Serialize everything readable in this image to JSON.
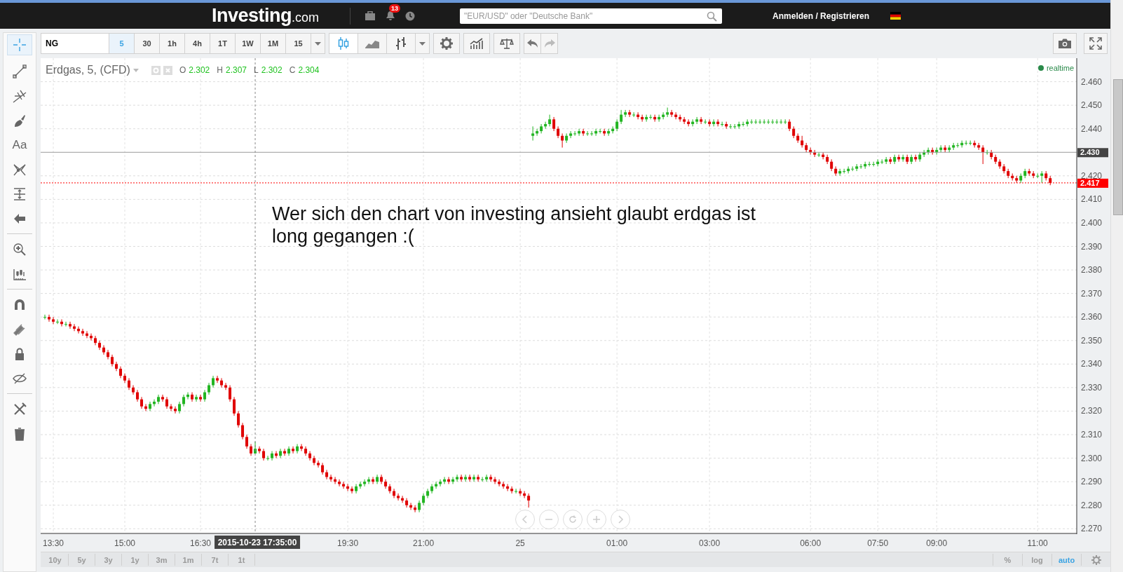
{
  "header": {
    "logo_name": "Investing",
    "logo_suffix": ".com",
    "notification_count": "13",
    "search": {
      "placeholder": "\"EUR/USD\" oder \"Deutsche Bank\""
    },
    "login_link": "Anmelden / Registrieren"
  },
  "toolbar": {
    "symbol": "NG",
    "intervals": [
      {
        "label": "5",
        "selected": true
      },
      {
        "label": "30",
        "selected": false
      },
      {
        "label": "1h",
        "selected": false
      },
      {
        "label": "4h",
        "selected": false
      },
      {
        "label": "1T",
        "selected": false
      },
      {
        "label": "1W",
        "selected": false
      },
      {
        "label": "1M",
        "selected": false
      },
      {
        "label": "15",
        "selected": false
      }
    ],
    "chart_types": [
      {
        "selected": true
      },
      {
        "selected": false
      },
      {
        "selected": false
      }
    ]
  },
  "drawing_tools": [
    {
      "selected": true
    },
    {
      "selected": false
    },
    {
      "selected": false
    },
    {
      "selected": false
    },
    {
      "label": "Aa",
      "selected": false
    },
    {
      "selected": false
    },
    {
      "selected": false
    },
    {
      "selected": false
    },
    {
      "selected": false
    },
    {
      "selected": false
    },
    {
      "selected": false
    },
    {
      "selected": false
    },
    {
      "selected": false
    },
    {
      "selected": false
    },
    {
      "selected": false
    },
    {
      "selected": false
    }
  ],
  "legend": {
    "title": "Erdgas, 5, (CFD)",
    "ohlc": [
      {
        "label": "O",
        "value": "2.302"
      },
      {
        "label": "H",
        "value": "2.307"
      },
      {
        "label": "L",
        "value": "2.302"
      },
      {
        "label": "C",
        "value": "2.304"
      }
    ],
    "status": "realtime"
  },
  "annotation": "Wer sich den chart von investing ansieht glaubt erdgas ist long gegangen :(",
  "chart_data": {
    "type": "candlestick",
    "grid": true,
    "ylim": [
      2.268,
      2.47
    ],
    "categories": [
      null,
      null,
      "13:30",
      null,
      null,
      null,
      null,
      null,
      null,
      null,
      null,
      null,
      null,
      null,
      null,
      null,
      null,
      null,
      null,
      "15:00",
      null,
      null,
      null,
      null,
      null,
      null,
      null,
      null,
      null,
      null,
      null,
      null,
      null,
      null,
      null,
      null,
      null,
      "16:30",
      null,
      null,
      null,
      null,
      null,
      null,
      null,
      null,
      null,
      null,
      null,
      null,
      "2015-10-23 17:35:00",
      null,
      null,
      null,
      null,
      null,
      null,
      null,
      null,
      null,
      null,
      null,
      null,
      null,
      null,
      null,
      null,
      null,
      null,
      null,
      null,
      null,
      "19:30",
      null,
      null,
      null,
      null,
      null,
      null,
      null,
      null,
      null,
      null,
      null,
      null,
      null,
      null,
      null,
      null,
      null,
      "21:00",
      null,
      null,
      null,
      null,
      null,
      null,
      null,
      null,
      null,
      null,
      null,
      null,
      null,
      null,
      null,
      null,
      null,
      null,
      null,
      null,
      null,
      null,
      "25",
      null,
      null,
      null,
      null,
      null,
      null,
      null,
      null,
      null,
      null,
      null,
      null,
      null,
      null,
      null,
      null,
      null,
      null,
      null,
      null,
      null,
      null,
      "01:00",
      null,
      null,
      null,
      null,
      null,
      null,
      null,
      null,
      null,
      null,
      null,
      null,
      null,
      null,
      null,
      null,
      null,
      null,
      null,
      null,
      null,
      "03:00",
      null,
      null,
      null,
      null,
      null,
      null,
      null,
      null,
      null,
      null,
      null,
      null,
      null,
      null,
      null,
      null,
      null,
      null,
      null,
      null,
      null,
      null,
      null,
      "06:00",
      null,
      null,
      null,
      null,
      null,
      null,
      null,
      null,
      null,
      null,
      null,
      null,
      null,
      null,
      null,
      "07:50",
      null,
      null,
      null,
      null,
      null,
      null,
      null,
      null,
      null,
      null,
      null,
      null,
      null,
      "09:00",
      null,
      null,
      null,
      null,
      null,
      null,
      null,
      null,
      null,
      null,
      null,
      null,
      null,
      null,
      null,
      null,
      null,
      null,
      null,
      null,
      null,
      null,
      null,
      "11:00",
      null,
      null,
      null
    ],
    "ohlc": [
      [
        2.36,
        2.361,
        2.359,
        2.36
      ],
      [
        2.36,
        2.361,
        2.358,
        2.359
      ],
      [
        2.359,
        2.36,
        2.357,
        2.358
      ],
      [
        2.358,
        2.359,
        2.357,
        2.358
      ],
      [
        2.358,
        2.359,
        2.356,
        2.357
      ],
      [
        2.357,
        2.358,
        2.356,
        2.357
      ],
      [
        2.357,
        2.358,
        2.355,
        2.356
      ],
      [
        2.356,
        2.357,
        2.354,
        2.355
      ],
      [
        2.355,
        2.356,
        2.353,
        2.354
      ],
      [
        2.354,
        2.355,
        2.352,
        2.353
      ],
      [
        2.353,
        2.354,
        2.351,
        2.352
      ],
      [
        2.352,
        2.353,
        2.35,
        2.351
      ],
      [
        2.351,
        2.352,
        2.348,
        2.349
      ],
      [
        2.349,
        2.35,
        2.346,
        2.347
      ],
      [
        2.347,
        2.348,
        2.344,
        2.345
      ],
      [
        2.345,
        2.346,
        2.342,
        2.343
      ],
      [
        2.343,
        2.344,
        2.339,
        2.34
      ],
      [
        2.34,
        2.341,
        2.337,
        2.338
      ],
      [
        2.338,
        2.339,
        2.334,
        2.335
      ],
      [
        2.335,
        2.336,
        2.332,
        2.333
      ],
      [
        2.333,
        2.334,
        2.329,
        2.33
      ],
      [
        2.33,
        2.331,
        2.327,
        2.328
      ],
      [
        2.328,
        2.329,
        2.324,
        2.325
      ],
      [
        2.325,
        2.326,
        2.321,
        2.322
      ],
      [
        2.322,
        2.323,
        2.32,
        2.321
      ],
      [
        2.321,
        2.324,
        2.32,
        2.323
      ],
      [
        2.323,
        2.325,
        2.322,
        2.324
      ],
      [
        2.324,
        2.327,
        2.323,
        2.326
      ],
      [
        2.326,
        2.327,
        2.324,
        2.325
      ],
      [
        2.325,
        2.326,
        2.321,
        2.322
      ],
      [
        2.322,
        2.323,
        2.32,
        2.321
      ],
      [
        2.321,
        2.322,
        2.319,
        2.32
      ],
      [
        2.32,
        2.324,
        2.319,
        2.323
      ],
      [
        2.323,
        2.327,
        2.322,
        2.326
      ],
      [
        2.326,
        2.328,
        2.325,
        2.327
      ],
      [
        2.327,
        2.328,
        2.324,
        2.325
      ],
      [
        2.325,
        2.327,
        2.324,
        2.326
      ],
      [
        2.326,
        2.327,
        2.324,
        2.325
      ],
      [
        2.325,
        2.329,
        2.324,
        2.328
      ],
      [
        2.328,
        2.332,
        2.327,
        2.331
      ],
      [
        2.331,
        2.335,
        2.33,
        2.334
      ],
      [
        2.334,
        2.335,
        2.332,
        2.333
      ],
      [
        2.333,
        2.334,
        2.33,
        2.331
      ],
      [
        2.331,
        2.332,
        2.329,
        2.33
      ],
      [
        2.33,
        2.331,
        2.324,
        2.325
      ],
      [
        2.325,
        2.326,
        2.318,
        2.319
      ],
      [
        2.319,
        2.32,
        2.313,
        2.314
      ],
      [
        2.314,
        2.315,
        2.308,
        2.309
      ],
      [
        2.309,
        2.31,
        2.304,
        2.305
      ],
      [
        2.305,
        2.306,
        2.301,
        2.302
      ],
      [
        2.302,
        2.307,
        2.302,
        2.304
      ],
      [
        2.304,
        2.305,
        2.302,
        2.303
      ],
      [
        2.303,
        2.304,
        2.299,
        2.3
      ],
      [
        2.3,
        2.301,
        2.299,
        2.3
      ],
      [
        2.3,
        2.303,
        2.299,
        2.302
      ],
      [
        2.302,
        2.303,
        2.3,
        2.301
      ],
      [
        2.301,
        2.304,
        2.3,
        2.303
      ],
      [
        2.303,
        2.304,
        2.301,
        2.302
      ],
      [
        2.302,
        2.305,
        2.301,
        2.304
      ],
      [
        2.304,
        2.305,
        2.302,
        2.303
      ],
      [
        2.303,
        2.306,
        2.302,
        2.305
      ],
      [
        2.305,
        2.306,
        2.303,
        2.304
      ],
      [
        2.304,
        2.305,
        2.301,
        2.302
      ],
      [
        2.302,
        2.303,
        2.299,
        2.3
      ],
      [
        2.3,
        2.301,
        2.297,
        2.298
      ],
      [
        2.298,
        2.299,
        2.296,
        2.297
      ],
      [
        2.297,
        2.298,
        2.293,
        2.294
      ],
      [
        2.294,
        2.295,
        2.291,
        2.292
      ],
      [
        2.292,
        2.293,
        2.29,
        2.291
      ],
      [
        2.291,
        2.292,
        2.289,
        2.29
      ],
      [
        2.29,
        2.291,
        2.288,
        2.289
      ],
      [
        2.289,
        2.29,
        2.287,
        2.288
      ],
      [
        2.288,
        2.289,
        2.286,
        2.287
      ],
      [
        2.287,
        2.288,
        2.285,
        2.286
      ],
      [
        2.286,
        2.289,
        2.285,
        2.288
      ],
      [
        2.288,
        2.29,
        2.287,
        2.289
      ],
      [
        2.289,
        2.291,
        2.288,
        2.29
      ],
      [
        2.29,
        2.292,
        2.289,
        2.291
      ],
      [
        2.291,
        2.292,
        2.289,
        2.29
      ],
      [
        2.29,
        2.293,
        2.289,
        2.292
      ],
      [
        2.292,
        2.293,
        2.289,
        2.29
      ],
      [
        2.29,
        2.291,
        2.287,
        2.288
      ],
      [
        2.288,
        2.289,
        2.285,
        2.286
      ],
      [
        2.286,
        2.287,
        2.283,
        2.284
      ],
      [
        2.284,
        2.285,
        2.282,
        2.283
      ],
      [
        2.283,
        2.284,
        2.281,
        2.282
      ],
      [
        2.282,
        2.283,
        2.279,
        2.28
      ],
      [
        2.28,
        2.281,
        2.278,
        2.279
      ],
      [
        2.279,
        2.28,
        2.277,
        2.278
      ],
      [
        2.278,
        2.282,
        2.277,
        2.281
      ],
      [
        2.281,
        2.285,
        2.28,
        2.284
      ],
      [
        2.284,
        2.287,
        2.283,
        2.286
      ],
      [
        2.286,
        2.289,
        2.285,
        2.288
      ],
      [
        2.288,
        2.29,
        2.287,
        2.289
      ],
      [
        2.289,
        2.291,
        2.288,
        2.29
      ],
      [
        2.29,
        2.292,
        2.289,
        2.291
      ],
      [
        2.291,
        2.292,
        2.289,
        2.29
      ],
      [
        2.29,
        2.292,
        2.289,
        2.291
      ],
      [
        2.291,
        2.293,
        2.29,
        2.292
      ],
      [
        2.292,
        2.293,
        2.29,
        2.291
      ],
      [
        2.291,
        2.293,
        2.29,
        2.292
      ],
      [
        2.292,
        2.293,
        2.29,
        2.291
      ],
      [
        2.291,
        2.293,
        2.29,
        2.292
      ],
      [
        2.292,
        2.293,
        2.29,
        2.291
      ],
      [
        2.291,
        2.292,
        2.29,
        2.291
      ],
      [
        2.291,
        2.293,
        2.29,
        2.292
      ],
      [
        2.292,
        2.293,
        2.29,
        2.291
      ],
      [
        2.291,
        2.292,
        2.289,
        2.29
      ],
      [
        2.29,
        2.291,
        2.288,
        2.289
      ],
      [
        2.289,
        2.29,
        2.287,
        2.288
      ],
      [
        2.288,
        2.289,
        2.286,
        2.287
      ],
      [
        2.287,
        2.288,
        2.285,
        2.286
      ],
      [
        2.286,
        2.287,
        2.285,
        2.286
      ],
      [
        2.286,
        2.287,
        2.284,
        2.285
      ],
      [
        2.285,
        2.286,
        2.283,
        2.284
      ],
      [
        2.284,
        2.285,
        2.279,
        2.282
      ],
      [
        2.437,
        2.441,
        2.435,
        2.438
      ],
      [
        2.438,
        2.44,
        2.437,
        2.439
      ],
      [
        2.439,
        2.442,
        2.438,
        2.441
      ],
      [
        2.441,
        2.443,
        2.44,
        2.442
      ],
      [
        2.442,
        2.446,
        2.441,
        2.444
      ],
      [
        2.444,
        2.445,
        2.439,
        2.44
      ],
      [
        2.44,
        2.441,
        2.436,
        2.437
      ],
      [
        2.437,
        2.438,
        2.432,
        2.435
      ],
      [
        2.435,
        2.438,
        2.434,
        2.437
      ],
      [
        2.437,
        2.439,
        2.436,
        2.438
      ],
      [
        2.438,
        2.439,
        2.437,
        2.438
      ],
      [
        2.438,
        2.44,
        2.437,
        2.439
      ],
      [
        2.439,
        2.44,
        2.437,
        2.438
      ],
      [
        2.438,
        2.439,
        2.437,
        2.438
      ],
      [
        2.438,
        2.439,
        2.437,
        2.438
      ],
      [
        2.438,
        2.44,
        2.437,
        2.439
      ],
      [
        2.439,
        2.44,
        2.438,
        2.439
      ],
      [
        2.439,
        2.44,
        2.437,
        2.438
      ],
      [
        2.438,
        2.44,
        2.437,
        2.439
      ],
      [
        2.439,
        2.441,
        2.438,
        2.44
      ],
      [
        2.44,
        2.444,
        2.439,
        2.443
      ],
      [
        2.443,
        2.448,
        2.442,
        2.446
      ],
      [
        2.446,
        2.448,
        2.445,
        2.447
      ],
      [
        2.447,
        2.448,
        2.445,
        2.446
      ],
      [
        2.446,
        2.447,
        2.445,
        2.446
      ],
      [
        2.446,
        2.447,
        2.444,
        2.445
      ],
      [
        2.445,
        2.446,
        2.443,
        2.444
      ],
      [
        2.444,
        2.446,
        2.443,
        2.445
      ],
      [
        2.445,
        2.446,
        2.444,
        2.445
      ],
      [
        2.445,
        2.446,
        2.443,
        2.444
      ],
      [
        2.444,
        2.446,
        2.443,
        2.445
      ],
      [
        2.445,
        2.447,
        2.444,
        2.446
      ],
      [
        2.446,
        2.449,
        2.445,
        2.447
      ],
      [
        2.447,
        2.448,
        2.445,
        2.446
      ],
      [
        2.446,
        2.447,
        2.444,
        2.445
      ],
      [
        2.445,
        2.446,
        2.443,
        2.444
      ],
      [
        2.444,
        2.445,
        2.442,
        2.443
      ],
      [
        2.443,
        2.444,
        2.441,
        2.442
      ],
      [
        2.442,
        2.444,
        2.441,
        2.443
      ],
      [
        2.443,
        2.445,
        2.442,
        2.444
      ],
      [
        2.444,
        2.445,
        2.442,
        2.443
      ],
      [
        2.443,
        2.444,
        2.442,
        2.443
      ],
      [
        2.443,
        2.444,
        2.441,
        2.442
      ],
      [
        2.442,
        2.444,
        2.441,
        2.443
      ],
      [
        2.443,
        2.444,
        2.441,
        2.442
      ],
      [
        2.442,
        2.443,
        2.441,
        2.442
      ],
      [
        2.442,
        2.443,
        2.44,
        2.441
      ],
      [
        2.441,
        2.442,
        2.44,
        2.441
      ],
      [
        2.441,
        2.442,
        2.44,
        2.441
      ],
      [
        2.441,
        2.443,
        2.44,
        2.442
      ],
      [
        2.442,
        2.443,
        2.441,
        2.442
      ],
      [
        2.442,
        2.444,
        2.441,
        2.443
      ],
      [
        2.443,
        2.444,
        2.442,
        2.443
      ],
      [
        2.443,
        2.444,
        2.442,
        2.443
      ],
      [
        2.443,
        2.444,
        2.442,
        2.443
      ],
      [
        2.443,
        2.444,
        2.442,
        2.443
      ],
      [
        2.443,
        2.444,
        2.442,
        2.443
      ],
      [
        2.443,
        2.444,
        2.442,
        2.443
      ],
      [
        2.443,
        2.444,
        2.442,
        2.443
      ],
      [
        2.443,
        2.444,
        2.442,
        2.443
      ],
      [
        2.443,
        2.444,
        2.442,
        2.443
      ],
      [
        2.443,
        2.444,
        2.439,
        2.44
      ],
      [
        2.44,
        2.441,
        2.436,
        2.437
      ],
      [
        2.437,
        2.438,
        2.434,
        2.435
      ],
      [
        2.435,
        2.437,
        2.432,
        2.433
      ],
      [
        2.433,
        2.434,
        2.43,
        2.431
      ],
      [
        2.431,
        2.432,
        2.429,
        2.43
      ],
      [
        2.43,
        2.431,
        2.428,
        2.429
      ],
      [
        2.429,
        2.43,
        2.428,
        2.429
      ],
      [
        2.429,
        2.43,
        2.427,
        2.428
      ],
      [
        2.428,
        2.429,
        2.425,
        2.426
      ],
      [
        2.426,
        2.427,
        2.422,
        2.423
      ],
      [
        2.423,
        2.424,
        2.42,
        2.421
      ],
      [
        2.421,
        2.423,
        2.42,
        2.422
      ],
      [
        2.422,
        2.423,
        2.421,
        2.422
      ],
      [
        2.422,
        2.424,
        2.421,
        2.423
      ],
      [
        2.423,
        2.424,
        2.422,
        2.423
      ],
      [
        2.423,
        2.425,
        2.422,
        2.424
      ],
      [
        2.424,
        2.425,
        2.423,
        2.424
      ],
      [
        2.424,
        2.426,
        2.423,
        2.425
      ],
      [
        2.425,
        2.426,
        2.424,
        2.425
      ],
      [
        2.425,
        2.426,
        2.424,
        2.425
      ],
      [
        2.425,
        2.427,
        2.424,
        2.426
      ],
      [
        2.426,
        2.427,
        2.425,
        2.426
      ],
      [
        2.426,
        2.428,
        2.425,
        2.427
      ],
      [
        2.427,
        2.428,
        2.425,
        2.426
      ],
      [
        2.426,
        2.429,
        2.425,
        2.428
      ],
      [
        2.428,
        2.429,
        2.426,
        2.427
      ],
      [
        2.427,
        2.429,
        2.426,
        2.428
      ],
      [
        2.428,
        2.429,
        2.425,
        2.426
      ],
      [
        2.426,
        2.429,
        2.425,
        2.428
      ],
      [
        2.428,
        2.429,
        2.426,
        2.427
      ],
      [
        2.427,
        2.43,
        2.426,
        2.429
      ],
      [
        2.429,
        2.431,
        2.428,
        2.43
      ],
      [
        2.43,
        2.432,
        2.429,
        2.431
      ],
      [
        2.431,
        2.432,
        2.429,
        2.43
      ],
      [
        2.43,
        2.432,
        2.429,
        2.431
      ],
      [
        2.431,
        2.433,
        2.43,
        2.432
      ],
      [
        2.432,
        2.433,
        2.43,
        2.431
      ],
      [
        2.431,
        2.433,
        2.43,
        2.432
      ],
      [
        2.432,
        2.434,
        2.431,
        2.433
      ],
      [
        2.433,
        2.434,
        2.432,
        2.433
      ],
      [
        2.433,
        2.435,
        2.432,
        2.434
      ],
      [
        2.434,
        2.435,
        2.433,
        2.434
      ],
      [
        2.434,
        2.435,
        2.433,
        2.434
      ],
      [
        2.434,
        2.435,
        2.432,
        2.433
      ],
      [
        2.433,
        2.434,
        2.431,
        2.432
      ],
      [
        2.432,
        2.433,
        2.425,
        2.43
      ],
      [
        2.43,
        2.431,
        2.429,
        2.43
      ],
      [
        2.43,
        2.431,
        2.427,
        2.428
      ],
      [
        2.428,
        2.429,
        2.425,
        2.426
      ],
      [
        2.426,
        2.427,
        2.423,
        2.424
      ],
      [
        2.424,
        2.425,
        2.421,
        2.422
      ],
      [
        2.422,
        2.423,
        2.419,
        2.42
      ],
      [
        2.42,
        2.421,
        2.418,
        2.419
      ],
      [
        2.419,
        2.42,
        2.417,
        2.418
      ],
      [
        2.418,
        2.421,
        2.417,
        2.42
      ],
      [
        2.42,
        2.423,
        2.419,
        2.422
      ],
      [
        2.422,
        2.423,
        2.42,
        2.421
      ],
      [
        2.421,
        2.422,
        2.419,
        2.42
      ],
      [
        2.42,
        2.421,
        2.419,
        2.42
      ],
      [
        2.42,
        2.422,
        2.417,
        2.421
      ],
      [
        2.421,
        2.422,
        2.418,
        2.419
      ],
      [
        2.419,
        2.42,
        2.416,
        2.417
      ]
    ],
    "yticks": [
      {
        "value": 2.27,
        "label": "2.270"
      },
      {
        "value": 2.28,
        "label": "2.280"
      },
      {
        "value": 2.29,
        "label": "2.290"
      },
      {
        "value": 2.3,
        "label": "2.300"
      },
      {
        "value": 2.31,
        "label": "2.310"
      },
      {
        "value": 2.32,
        "label": "2.320"
      },
      {
        "value": 2.33,
        "label": "2.330"
      },
      {
        "value": 2.34,
        "label": "2.340"
      },
      {
        "value": 2.35,
        "label": "2.350"
      },
      {
        "value": 2.36,
        "label": "2.360"
      },
      {
        "value": 2.37,
        "label": "2.370"
      },
      {
        "value": 2.38,
        "label": "2.380"
      },
      {
        "value": 2.39,
        "label": "2.390"
      },
      {
        "value": 2.4,
        "label": "2.400"
      },
      {
        "value": 2.41,
        "label": "2.410"
      },
      {
        "value": 2.42,
        "label": "2.420"
      },
      {
        "value": 2.44,
        "label": "2.440"
      },
      {
        "value": 2.45,
        "label": "2.450"
      },
      {
        "value": 2.46,
        "label": "2.460"
      }
    ],
    "ref_lines": [
      {
        "axis": "x",
        "value": "2015-10-23 17:35:00",
        "color": "#888888"
      },
      {
        "axis": "y",
        "value": 2.43,
        "label": "2.430",
        "color": "#999999"
      },
      {
        "axis": "y",
        "value": 2.417,
        "label": "2.417",
        "color": "#ff0000"
      }
    ]
  },
  "ranges": [
    "10y",
    "5y",
    "3y",
    "1y",
    "3m",
    "1m",
    "7t",
    "1t"
  ],
  "scale_options": [
    {
      "label": "%",
      "selected": false
    },
    {
      "label": "log",
      "selected": false
    },
    {
      "label": "auto",
      "selected": true
    }
  ]
}
